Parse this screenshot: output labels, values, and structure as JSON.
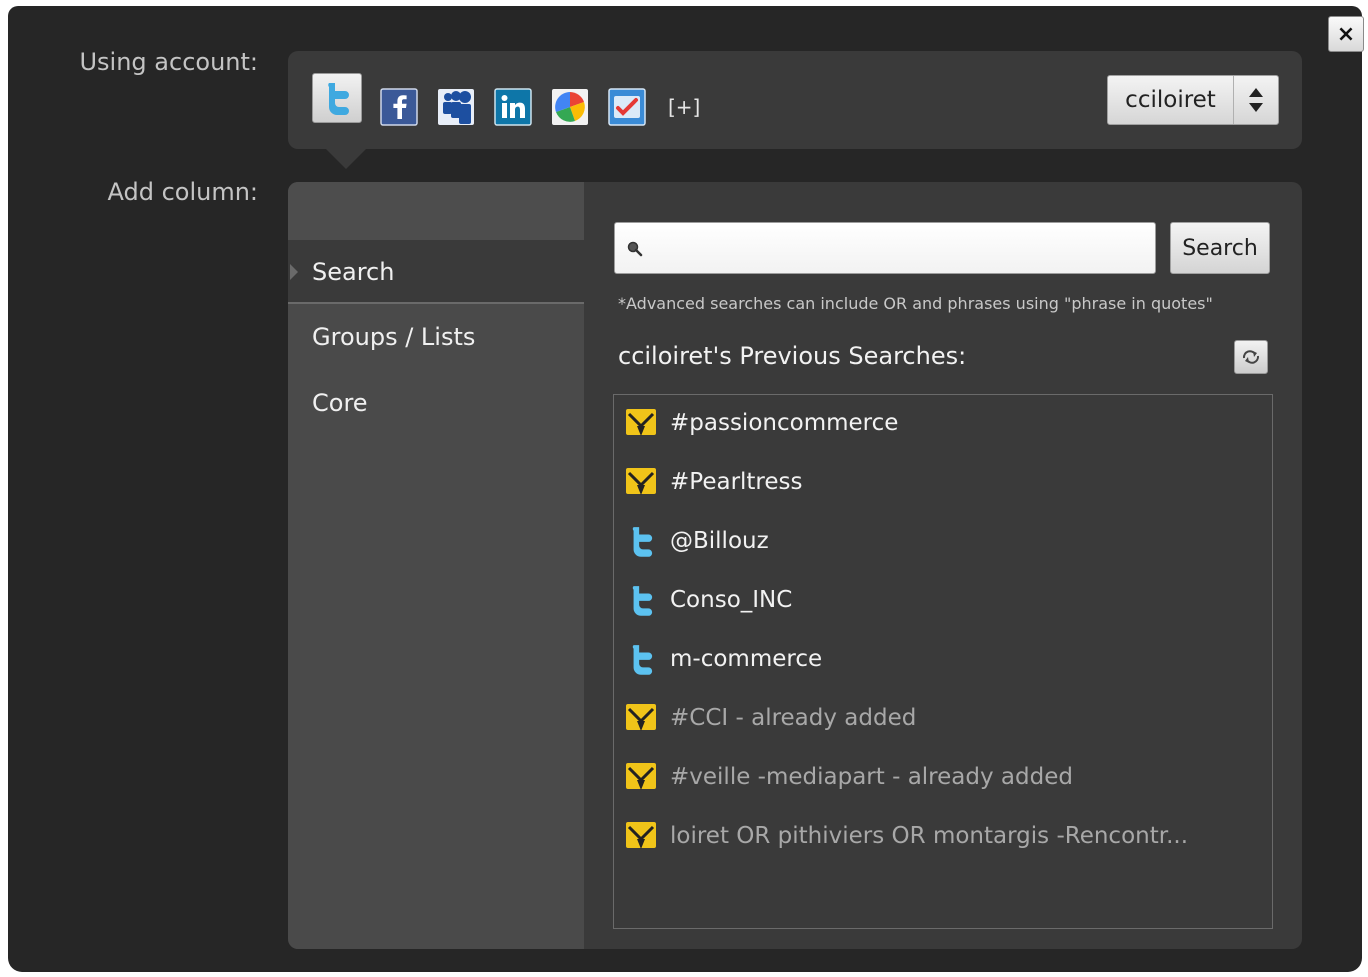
{
  "dialog": {
    "close_label": "×"
  },
  "account": {
    "label": "Using account:",
    "services": [
      {
        "name": "twitter-icon",
        "color": "#3fa9e0"
      },
      {
        "name": "facebook-icon",
        "color": "#3b5998"
      },
      {
        "name": "myspace-icon",
        "color": "#1d4fa0"
      },
      {
        "name": "linkedin-icon",
        "color": "#0e76a8"
      },
      {
        "name": "google-buzz-icon",
        "color": "#34a853"
      },
      {
        "name": "foursquare-icon",
        "color": "#3a8bd6"
      }
    ],
    "add_label": "[+]",
    "selected": "cciloiret"
  },
  "add_column": {
    "label": "Add column:",
    "menu": [
      {
        "label": "Search",
        "active": true
      },
      {
        "label": "Groups / Lists",
        "active": false
      },
      {
        "label": "Core",
        "active": false
      }
    ]
  },
  "search": {
    "value": "",
    "placeholder": "",
    "button_label": "Search",
    "hint": "*Advanced searches can include OR and phrases using \"phrase in quotes\"",
    "previous_title": "cciloiret's Previous Searches:",
    "items": [
      {
        "label": "#passioncommerce",
        "icon": "hootsuite-icon",
        "added": false
      },
      {
        "label": "#Pearltress",
        "icon": "hootsuite-icon",
        "added": false
      },
      {
        "label": "@Billouz",
        "icon": "twitter-icon",
        "added": false
      },
      {
        "label": "Conso_INC",
        "icon": "twitter-icon",
        "added": false
      },
      {
        "label": "m-commerce",
        "icon": "twitter-icon",
        "added": false
      },
      {
        "label": "#CCI - already added",
        "icon": "hootsuite-icon",
        "added": true
      },
      {
        "label": "#veille -mediapart - already added",
        "icon": "hootsuite-icon",
        "added": true
      },
      {
        "label": "loiret OR pithiviers OR montargis -Rencontr...",
        "icon": "hootsuite-icon",
        "added": true
      }
    ]
  }
}
